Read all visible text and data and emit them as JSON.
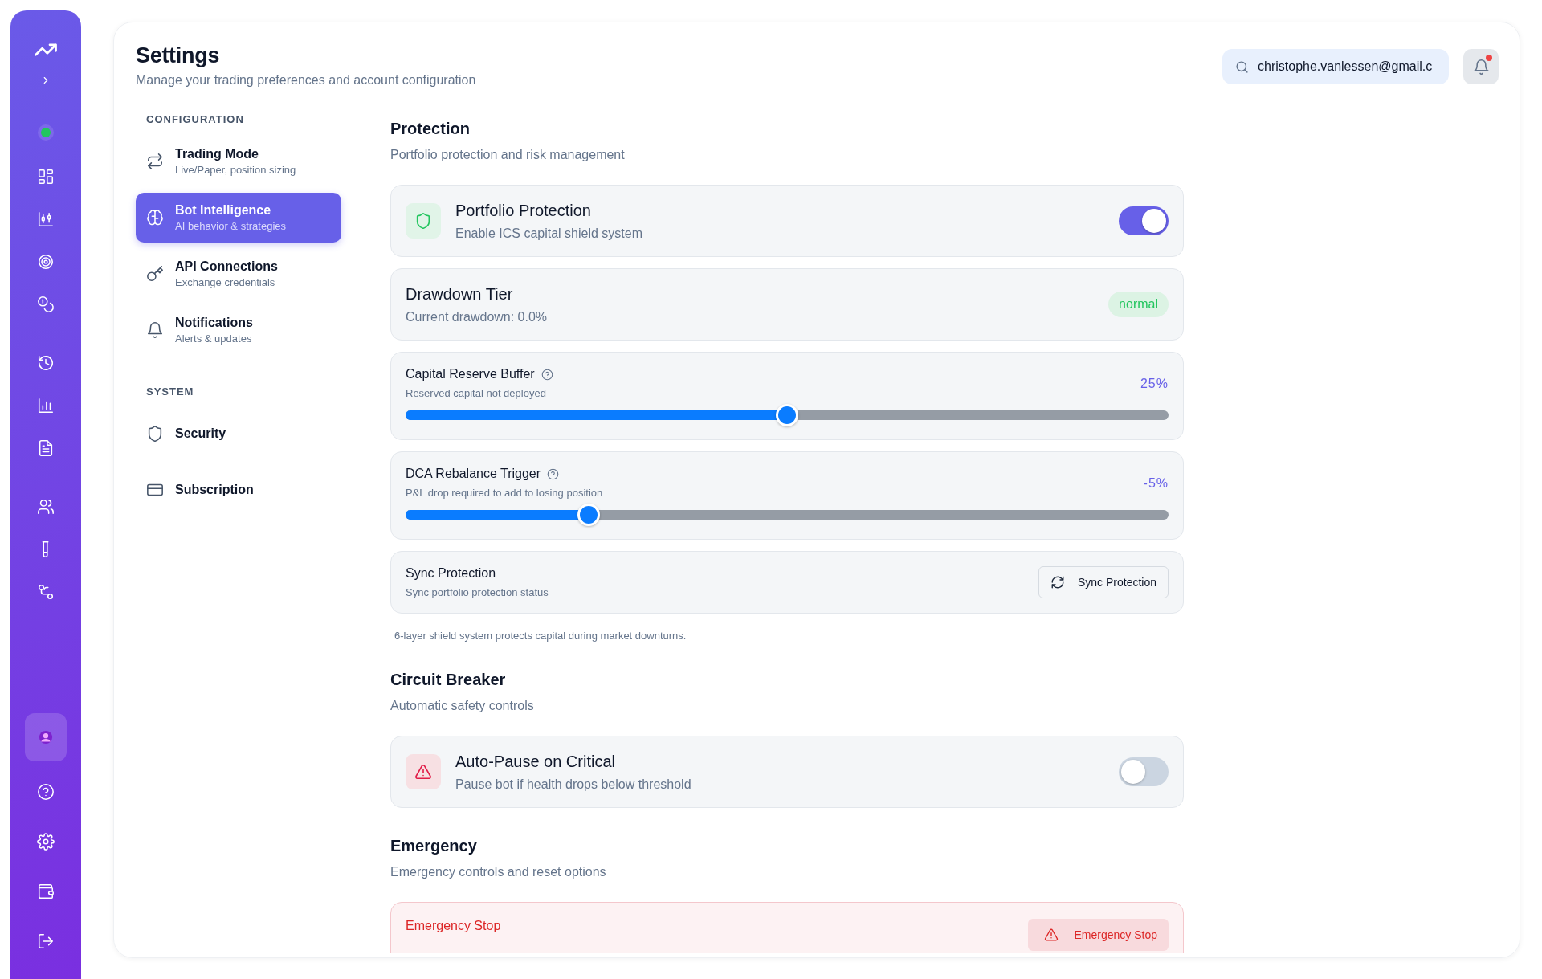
{
  "header": {
    "title": "Settings",
    "subtitle": "Manage your trading preferences and account configuration",
    "search": {
      "value": "christophe.vanlessen@gmail.c"
    },
    "notifications": {
      "unread": true
    }
  },
  "nav": [
    {
      "heading": "CONFIGURATION",
      "items": [
        {
          "label": "Trading Mode",
          "sublabel": "Live/Paper, position sizing",
          "selected": false
        },
        {
          "label": "Bot Intelligence",
          "sublabel": "AI behavior & strategies",
          "selected": true
        },
        {
          "label": "API Connections",
          "sublabel": "Exchange credentials",
          "selected": false
        },
        {
          "label": "Notifications",
          "sublabel": "Alerts & updates",
          "selected": false
        }
      ]
    },
    {
      "heading": "SYSTEM",
      "items": [
        {
          "label": "Security",
          "selected": false
        },
        {
          "label": "Subscription",
          "selected": false
        }
      ]
    }
  ],
  "sections": [
    {
      "title": "Protection",
      "subtitle": "Portfolio protection and risk management",
      "items": [
        {
          "kind": "toggle",
          "title": "Portfolio Protection",
          "subtitle": "Enable ICS capital shield system",
          "on": true
        },
        {
          "kind": "badge",
          "title": "Drawdown Tier",
          "subtitle": "Current drawdown: 0.0%",
          "badge": "normal"
        },
        {
          "kind": "slider",
          "title": "Capital Reserve Buffer",
          "subtitle": "Reserved capital not deployed",
          "reading": "25%",
          "level": 0.5
        },
        {
          "kind": "slider",
          "title": "DCA Rebalance Trigger",
          "subtitle": "P&L drop required to add to losing position",
          "reading": "-5%",
          "level": 0.24
        },
        {
          "kind": "action",
          "title": "Sync Protection",
          "subtitle": "Sync portfolio protection status",
          "button": "Sync Protection"
        }
      ],
      "note": "6-layer shield system protects capital during market downturns."
    },
    {
      "title": "Circuit Breaker",
      "subtitle": "Automatic safety controls",
      "items": [
        {
          "kind": "toggle",
          "title": "Auto-Pause on Critical",
          "subtitle": "Pause bot if health drops below threshold",
          "on": false
        }
      ]
    },
    {
      "title": "Emergency",
      "subtitle": "Emergency controls and reset options",
      "items": [
        {
          "kind": "danger",
          "title": "Emergency Stop",
          "button": "Emergency Stop"
        }
      ]
    }
  ]
}
